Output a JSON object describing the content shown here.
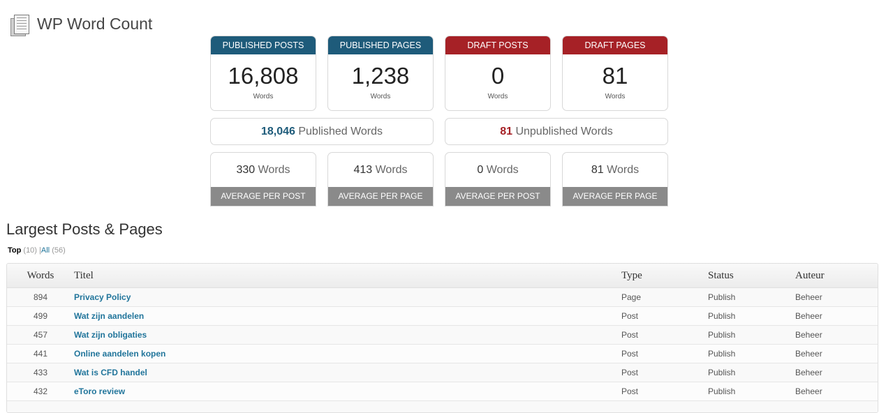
{
  "header": {
    "title": "WP Word Count",
    "icon": "document-icon"
  },
  "stats": [
    {
      "label": "PUBLISHED POSTS",
      "value": "16,808",
      "unit": "Words",
      "color": "#1e5b7a"
    },
    {
      "label": "PUBLISHED PAGES",
      "value": "1,238",
      "unit": "Words",
      "color": "#1e5b7a"
    },
    {
      "label": "DRAFT POSTS",
      "value": "0",
      "unit": "Words",
      "color": "#a62126"
    },
    {
      "label": "DRAFT PAGES",
      "value": "81",
      "unit": "Words",
      "color": "#a62126"
    }
  ],
  "totals": {
    "published": {
      "value": "18,046",
      "label": "Published Words"
    },
    "unpublished": {
      "value": "81",
      "label": "Unpublished Words"
    }
  },
  "averages": [
    {
      "value": "330",
      "unit": "Words",
      "label": "AVERAGE PER POST"
    },
    {
      "value": "413",
      "unit": "Words",
      "label": "AVERAGE PER PAGE"
    },
    {
      "value": "0",
      "unit": "Words",
      "label": "AVERAGE PER POST"
    },
    {
      "value": "81",
      "unit": "Words",
      "label": "AVERAGE PER PAGE"
    }
  ],
  "section": {
    "title": "Largest Posts & Pages",
    "filters": {
      "top_label": "Top",
      "top_count": "(10)",
      "separator": "|",
      "all_label": "All",
      "all_count": "(56)"
    }
  },
  "table": {
    "columns": [
      "Words",
      "Titel",
      "Type",
      "Status",
      "Auteur"
    ],
    "rows": [
      [
        "894",
        "Privacy Policy",
        "Page",
        "Publish",
        "Beheer"
      ],
      [
        "499",
        "Wat zijn aandelen",
        "Post",
        "Publish",
        "Beheer"
      ],
      [
        "457",
        "Wat zijn obligaties",
        "Post",
        "Publish",
        "Beheer"
      ],
      [
        "441",
        "Online aandelen kopen",
        "Post",
        "Publish",
        "Beheer"
      ],
      [
        "433",
        "Wat is CFD handel",
        "Post",
        "Publish",
        "Beheer"
      ],
      [
        "432",
        "eToro review",
        "Post",
        "Publish",
        "Beheer"
      ]
    ]
  },
  "colors": {
    "blue": "#1e5b7a",
    "red": "#a62126",
    "link": "#21759b",
    "gray_footer": "#8a8a8a"
  }
}
